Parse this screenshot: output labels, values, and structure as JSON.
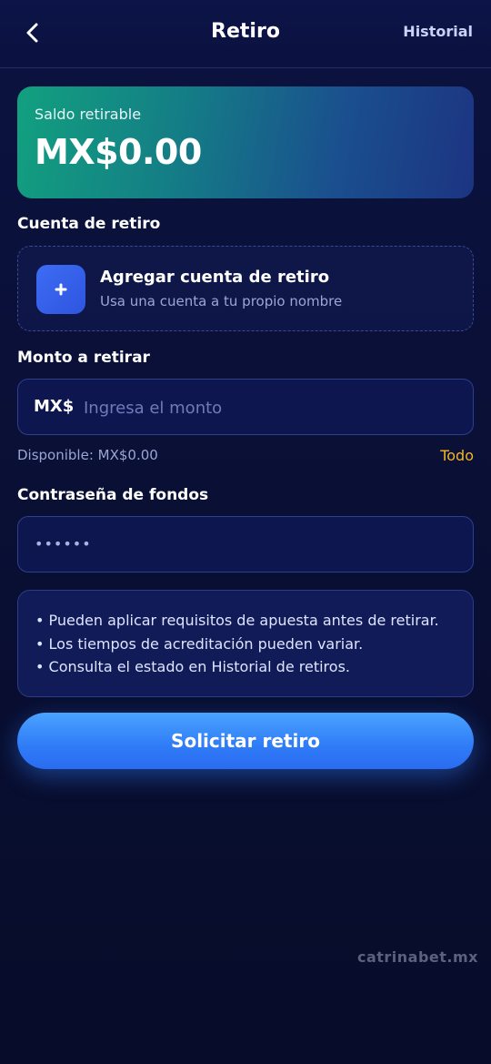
{
  "header": {
    "title": "Retiro",
    "history_label": "Historial"
  },
  "balance": {
    "label": "Saldo retirable",
    "value": "MX$0.00"
  },
  "account_section": {
    "label": "Cuenta de retiro",
    "add_title": "Agregar cuenta de retiro",
    "add_subtitle": "Usa una cuenta a tu propio nombre"
  },
  "amount_section": {
    "label": "Monto a retirar",
    "currency": "MX$",
    "placeholder": "Ingresa el monto",
    "available": "Disponible: MX$0.00",
    "all_label": "Todo"
  },
  "password_section": {
    "label": "Contraseña de fondos",
    "masked_value": "••••••"
  },
  "info": {
    "lines": [
      "• Pueden aplicar requisitos de apuesta antes de retirar.",
      "• Los tiempos de acreditación pueden variar.",
      "• Consulta el estado en Historial de retiros."
    ]
  },
  "submit": {
    "label": "Solicitar retiro"
  },
  "watermark": "catrinabet.mx",
  "colors": {
    "background": "#0a1036",
    "accent_blue": "#2f7bf7",
    "gold": "#f3b62a",
    "balance_gradient_start": "#12a07f",
    "balance_gradient_end": "#1c3482"
  },
  "icons": {
    "back": "chevron-left-icon",
    "add": "plus-icon"
  }
}
